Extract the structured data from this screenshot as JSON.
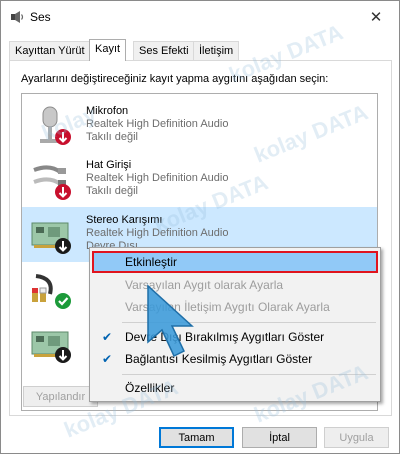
{
  "window": {
    "title": "Ses",
    "close_glyph": "✕"
  },
  "tabs": [
    "Kayıttan Yürüt",
    "Kayıt",
    "Ses Efekti",
    "İletişim"
  ],
  "instruction": "Ayarlarını değiştireceğiniz kayıt yapma aygıtını aşağıdan seçin:",
  "devices": [
    {
      "name": "Mikrofon",
      "description": "Realtek High Definition Audio",
      "status": "Takılı değil",
      "icon": "microphone-icon",
      "badge": "red-down-arrow"
    },
    {
      "name": "Hat Girişi",
      "description": "Realtek High Definition Audio",
      "status": "Takılı değil",
      "icon": "line-in-cable-icon",
      "badge": "red-down-arrow"
    },
    {
      "name": "Stereo Karışımı",
      "description": "Realtek High Definition Audio",
      "status": "Devre Dışı",
      "icon": "sound-card-icon",
      "badge": "black-down-arrow"
    },
    {
      "name": "",
      "description": "",
      "status": "",
      "icon": "audio-cable-icon",
      "badge": "green-check"
    },
    {
      "name": "",
      "description": "",
      "status": "",
      "icon": "sound-card-icon",
      "badge": "black-down-arrow"
    }
  ],
  "buttons": {
    "configure": "Yapılandır",
    "ok": "Tamam",
    "cancel": "İptal",
    "apply": "Uygula"
  },
  "context_menu": {
    "enable": "Etkinleştir",
    "set_default": "Varsayılan Aygıt olarak Ayarla",
    "set_default_comm": "Varsayılan İletişim Aygıtı Olarak Ayarla",
    "show_disabled": "Devre Dışı Bırakılmış Aygıtları Göster",
    "show_disconnected": "Bağlantısı Kesilmiş Aygıtları Göster",
    "properties": "Özellikler"
  },
  "watermark": {
    "brand_a": "kolay",
    "brand_b": "DATA"
  },
  "colors": {
    "selection": "#cce8ff",
    "menu_highlight": "#91c9f7",
    "highlight_border": "#e0141e",
    "cursor": "#3a9ad9",
    "check": "#0063b1"
  }
}
